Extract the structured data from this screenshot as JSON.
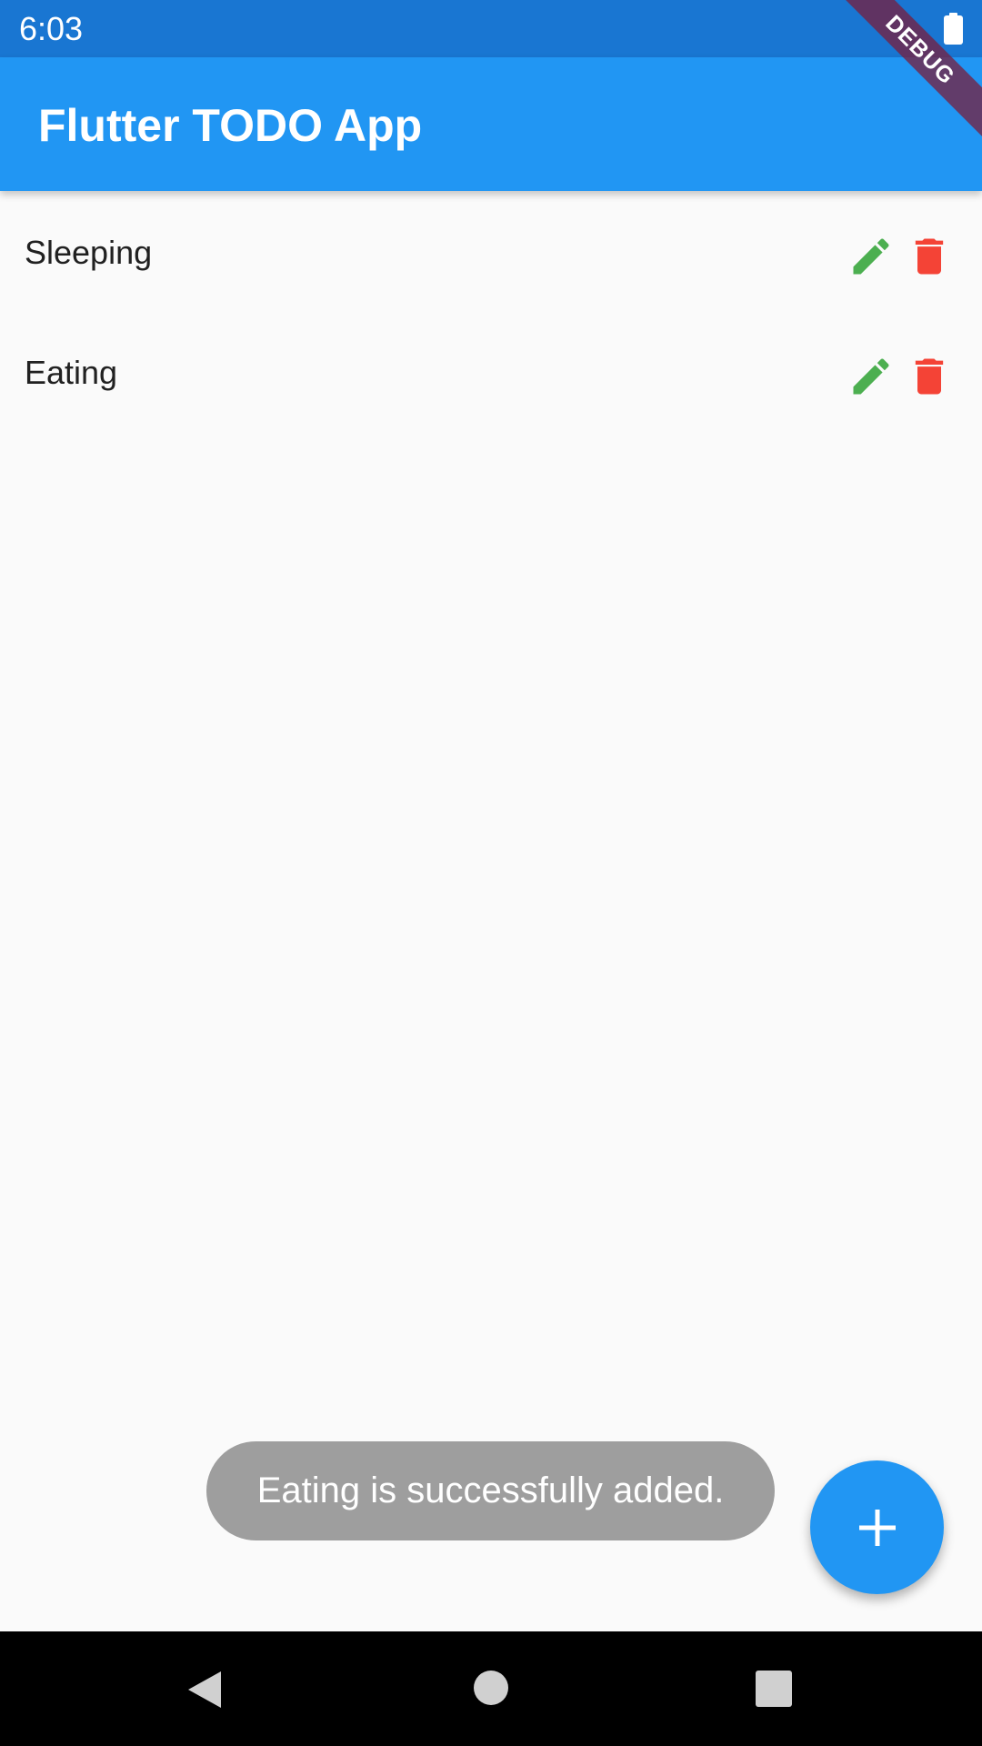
{
  "status_bar": {
    "time": "6:03",
    "battery_icon": "battery-full-icon"
  },
  "debug_banner": {
    "label": "DEBUG"
  },
  "app_bar": {
    "title": "Flutter TODO App",
    "color": "#2196f3"
  },
  "todos": [
    {
      "label": "Sleeping",
      "edit_icon": "pencil-icon",
      "delete_icon": "trash-icon"
    },
    {
      "label": "Eating",
      "edit_icon": "pencil-icon",
      "delete_icon": "trash-icon"
    }
  ],
  "toast": {
    "message": "Eating is successfully added."
  },
  "fab": {
    "icon": "plus-icon"
  },
  "nav_bar": {
    "back_icon": "back-triangle-icon",
    "home_icon": "home-circle-icon",
    "recents_icon": "recents-square-icon"
  },
  "colors": {
    "primary": "#2196f3",
    "status_bar": "#1976d2",
    "edit": "#4caf50",
    "delete": "#f44336",
    "toast_bg": "#9e9e9e",
    "background": "#fafafa"
  }
}
